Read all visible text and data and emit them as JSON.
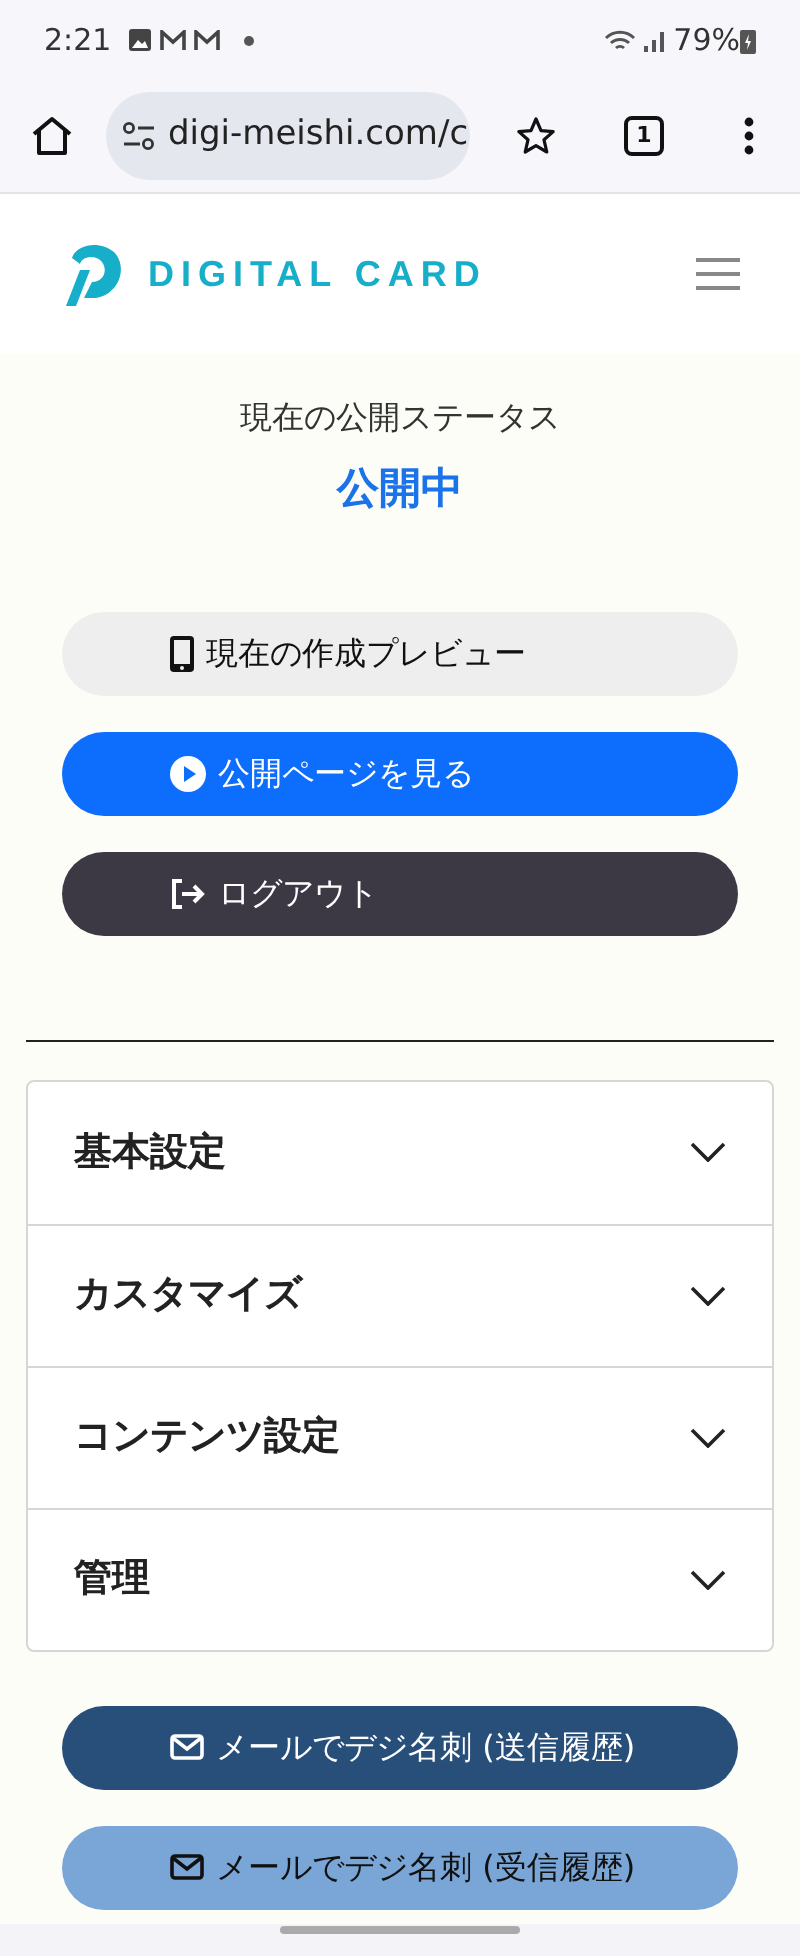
{
  "status_bar": {
    "time": "2:21",
    "battery": "79%"
  },
  "browser": {
    "url": "digi-meishi.com/c",
    "tab_count": "1"
  },
  "header": {
    "logo_text": "DIGITAL CARD"
  },
  "publish_status": {
    "label": "現在の公開ステータス",
    "value": "公開中"
  },
  "actions": [
    {
      "label": "現在の作成プレビュー",
      "kind": "light"
    },
    {
      "label": "公開ページを見る",
      "kind": "primary"
    },
    {
      "label": "ログアウト",
      "kind": "dark"
    }
  ],
  "sections": [
    {
      "label": "基本設定",
      "expanded": false
    },
    {
      "label": "カスタマイズ",
      "expanded": false
    },
    {
      "label": "コンテンツ設定",
      "expanded": false
    },
    {
      "label": "管理",
      "expanded": false
    }
  ],
  "mail_actions": [
    {
      "label": "メールでデジ名刺 (送信履歴)",
      "kind": "navy"
    },
    {
      "label": "メールでデジ名刺 (受信履歴)",
      "kind": "sky"
    }
  ]
}
